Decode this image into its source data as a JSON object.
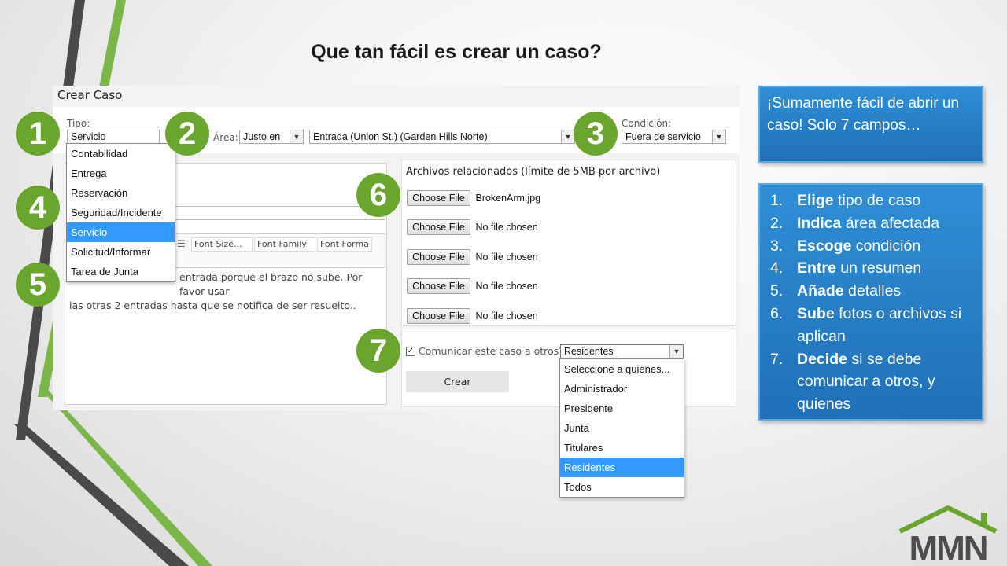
{
  "slide_title": "Que tan fácil es crear un caso?",
  "form": {
    "header": "Crear Caso",
    "tipo_label": "Tipo:",
    "tipo_value": "Servicio",
    "area_label": "Área:",
    "area_value": "Justo en",
    "location_value": "Entrada (Union St.) (Garden Hills Norte)",
    "condicion_label": "Condición:",
    "condicion_value": "Fuera de servicio",
    "tipo_options": [
      "Contabilidad",
      "Entrega",
      "Reservación",
      "Seguridad/Incidente",
      "Servicio",
      "Solicitud/Informar",
      "Tarea de Junta"
    ],
    "toolbar": {
      "font_size": "Font Size...",
      "font_family": "Font Family",
      "font_format": "Font Forma"
    },
    "detail_line1": "entrada porque el brazo no sube. Por favor usar",
    "detail_line2": "las otras 2 entradas hasta que se notifica de ser resuelto..",
    "files_title": "Archivos relacionados (límite de 5MB por archivo)",
    "choose_file_label": "Choose File",
    "files": [
      "BrokenArm.jpg",
      "No file chosen",
      "No file chosen",
      "No file chosen",
      "No file chosen"
    ],
    "communicate_label": "Comunicar este caso a otros?",
    "communicate_checked": "✓",
    "communicate_value": "Residentes",
    "communicate_options": [
      "Seleccione a quienes...",
      "Administrador",
      "Presidente",
      "Junta",
      "Titulares",
      "Residentes",
      "Todos"
    ],
    "crear_button": "Crear"
  },
  "badges": [
    "1",
    "2",
    "3",
    "4",
    "5",
    "6",
    "7"
  ],
  "callout_intro": "¡Sumamente fácil de abrir un caso! Solo 7 campos…",
  "steps": [
    {
      "num": "1.",
      "bold": "Elige",
      "rest": " tipo de caso"
    },
    {
      "num": "2.",
      "bold": "Indica",
      "rest": " área afectada"
    },
    {
      "num": "3.",
      "bold": "Escoge",
      "rest": " condición"
    },
    {
      "num": "4.",
      "bold": "Entre",
      "rest": " un resumen"
    },
    {
      "num": "5.",
      "bold": "Añade",
      "rest": " detalles"
    },
    {
      "num": "6.",
      "bold": "Sube",
      "rest": " fotos o archivos si aplican"
    },
    {
      "num": "7.",
      "bold": "Decide",
      "rest": " si se debe comunicar a otros, y quienes"
    }
  ],
  "logo_text": "MMN",
  "colors": {
    "accent_green": "#6aa52e",
    "callout_blue": "#2a84cc",
    "selected_blue": "#3399ff",
    "logo_gray": "#4d4d4d",
    "decor_dark": "#404040"
  }
}
